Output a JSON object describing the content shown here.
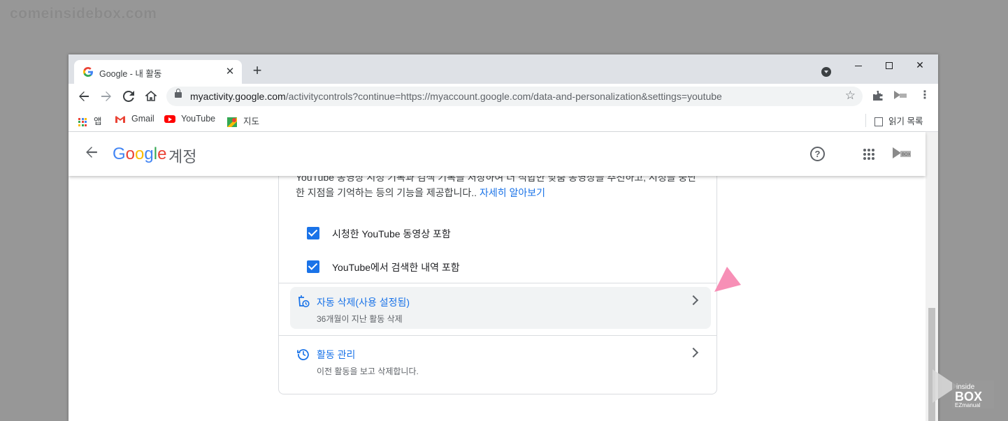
{
  "watermark": {
    "top_text": "comeinsidebox.com",
    "logo_lines": [
      "inside",
      "BOX",
      "EZmanual"
    ]
  },
  "browser": {
    "tab": {
      "title": "Google - 내 활동",
      "favicon": "google-g-icon"
    },
    "new_tab": "+",
    "window_buttons": {
      "minimize": "",
      "maximize": "",
      "close": "✕"
    },
    "url": {
      "host": "myactivity.google.com",
      "path": "/activitycontrols?continue=https://myaccount.google.com/data-and-personalization&settings=youtube"
    },
    "bookmarks": [
      {
        "label": "앱",
        "icon": "apps-grid-icon"
      },
      {
        "label": "Gmail",
        "icon": "gmail-icon"
      },
      {
        "label": "YouTube",
        "icon": "youtube-icon"
      },
      {
        "label": "지도",
        "icon": "maps-icon"
      }
    ],
    "reading_list": "읽기 목록"
  },
  "header": {
    "logo_text": "Google",
    "product": "계정"
  },
  "content": {
    "description_text": "YouTube 동영상 시청 기록과 검색 기록을 저장하여 더 적합한 맞춤 동영상을 추천하고, 시청을 중단한 지점을 기억하는 등의 기능을 제공합니다.. ",
    "learn_more": "자세히 알아보기",
    "checkboxes": [
      {
        "label": "시청한 YouTube 동영상 포함",
        "checked": true
      },
      {
        "label": "YouTube에서 검색한 내역 포함",
        "checked": true
      }
    ],
    "rows": [
      {
        "title": "자동 삭제(사용 설정됨)",
        "subtitle": "36개월이 지난 활동 삭제",
        "icon": "auto-delete-icon",
        "highlighted": true
      },
      {
        "title": "활동 관리",
        "subtitle": "이전 활동을 보고 삭제합니다.",
        "icon": "history-icon",
        "highlighted": false
      }
    ]
  },
  "colors": {
    "accent": "#1a73e8",
    "annotation_arrow": "#f78fb6"
  }
}
